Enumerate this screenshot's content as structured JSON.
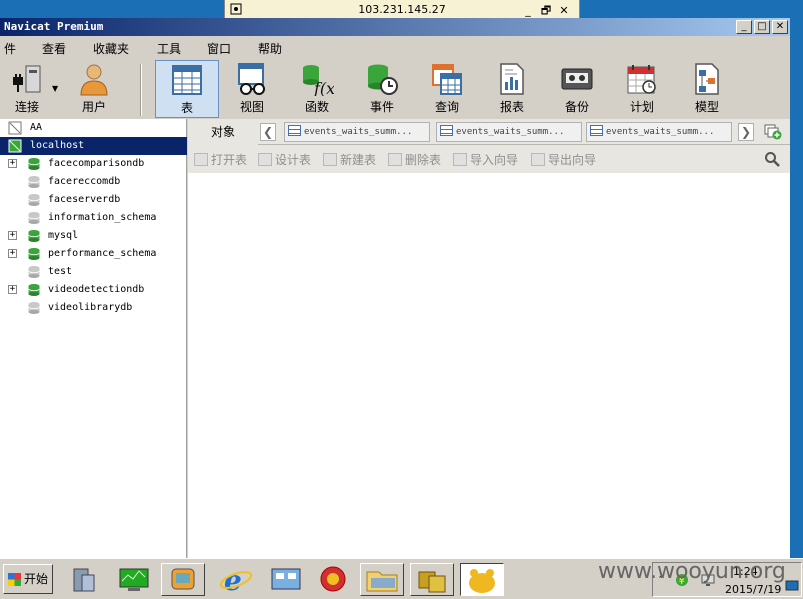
{
  "rdp": {
    "host": "103.231.145.27",
    "controls": [
      "_",
      "🗗",
      "✕"
    ]
  },
  "window": {
    "title": "Navicat Premium",
    "buttons": [
      "_",
      "□",
      "✕"
    ]
  },
  "menu": [
    "件",
    "查看",
    "收藏夹",
    "工具",
    "窗口",
    "帮助"
  ],
  "toolbar": [
    {
      "label": "连接",
      "icon": "connection-plug-icon"
    },
    {
      "label": "用户",
      "icon": "user-icon"
    },
    {
      "label": "表",
      "icon": "table-icon",
      "active": true
    },
    {
      "label": "视图",
      "icon": "view-glasses-icon"
    },
    {
      "label": "函数",
      "icon": "function-icon"
    },
    {
      "label": "事件",
      "icon": "event-clock-icon"
    },
    {
      "label": "查询",
      "icon": "query-icon"
    },
    {
      "label": "报表",
      "icon": "report-icon"
    },
    {
      "label": "备份",
      "icon": "backup-tape-icon"
    },
    {
      "label": "计划",
      "icon": "calendar-icon"
    },
    {
      "label": "模型",
      "icon": "model-icon"
    }
  ],
  "tree": {
    "connections": [
      "AA",
      "localhost"
    ],
    "databases": [
      {
        "name": "facecomparisondb",
        "expandable": true,
        "active": true
      },
      {
        "name": "facereccomdb",
        "expandable": false,
        "active": false
      },
      {
        "name": "faceserverdb",
        "expandable": false,
        "active": false
      },
      {
        "name": "information_schema",
        "expandable": false,
        "active": false
      },
      {
        "name": "mysql",
        "expandable": true,
        "active": true
      },
      {
        "name": "performance_schema",
        "expandable": true,
        "active": true
      },
      {
        "name": "test",
        "expandable": false,
        "active": false
      },
      {
        "name": "videodetectiondb",
        "expandable": true,
        "active": true
      },
      {
        "name": "videolibrarydb",
        "expandable": false,
        "active": false
      }
    ]
  },
  "tabs": {
    "objects_label": "对象",
    "docs": [
      "events_waits_summ...",
      "events_waits_summ...",
      "events_waits_summ..."
    ]
  },
  "actions": [
    "打开表",
    "设计表",
    "新建表",
    "删除表",
    "导入向导",
    "导出向导"
  ],
  "taskbar": {
    "start_label": "开始",
    "time": "1:24",
    "date": "2015/7/19",
    "watermark": "www.wooyun.org"
  },
  "colors": {
    "selection": "#0a246a",
    "db_active": "#3aa53a",
    "db_inactive": "#c8c8c8",
    "titlebar": "#0a246a"
  }
}
